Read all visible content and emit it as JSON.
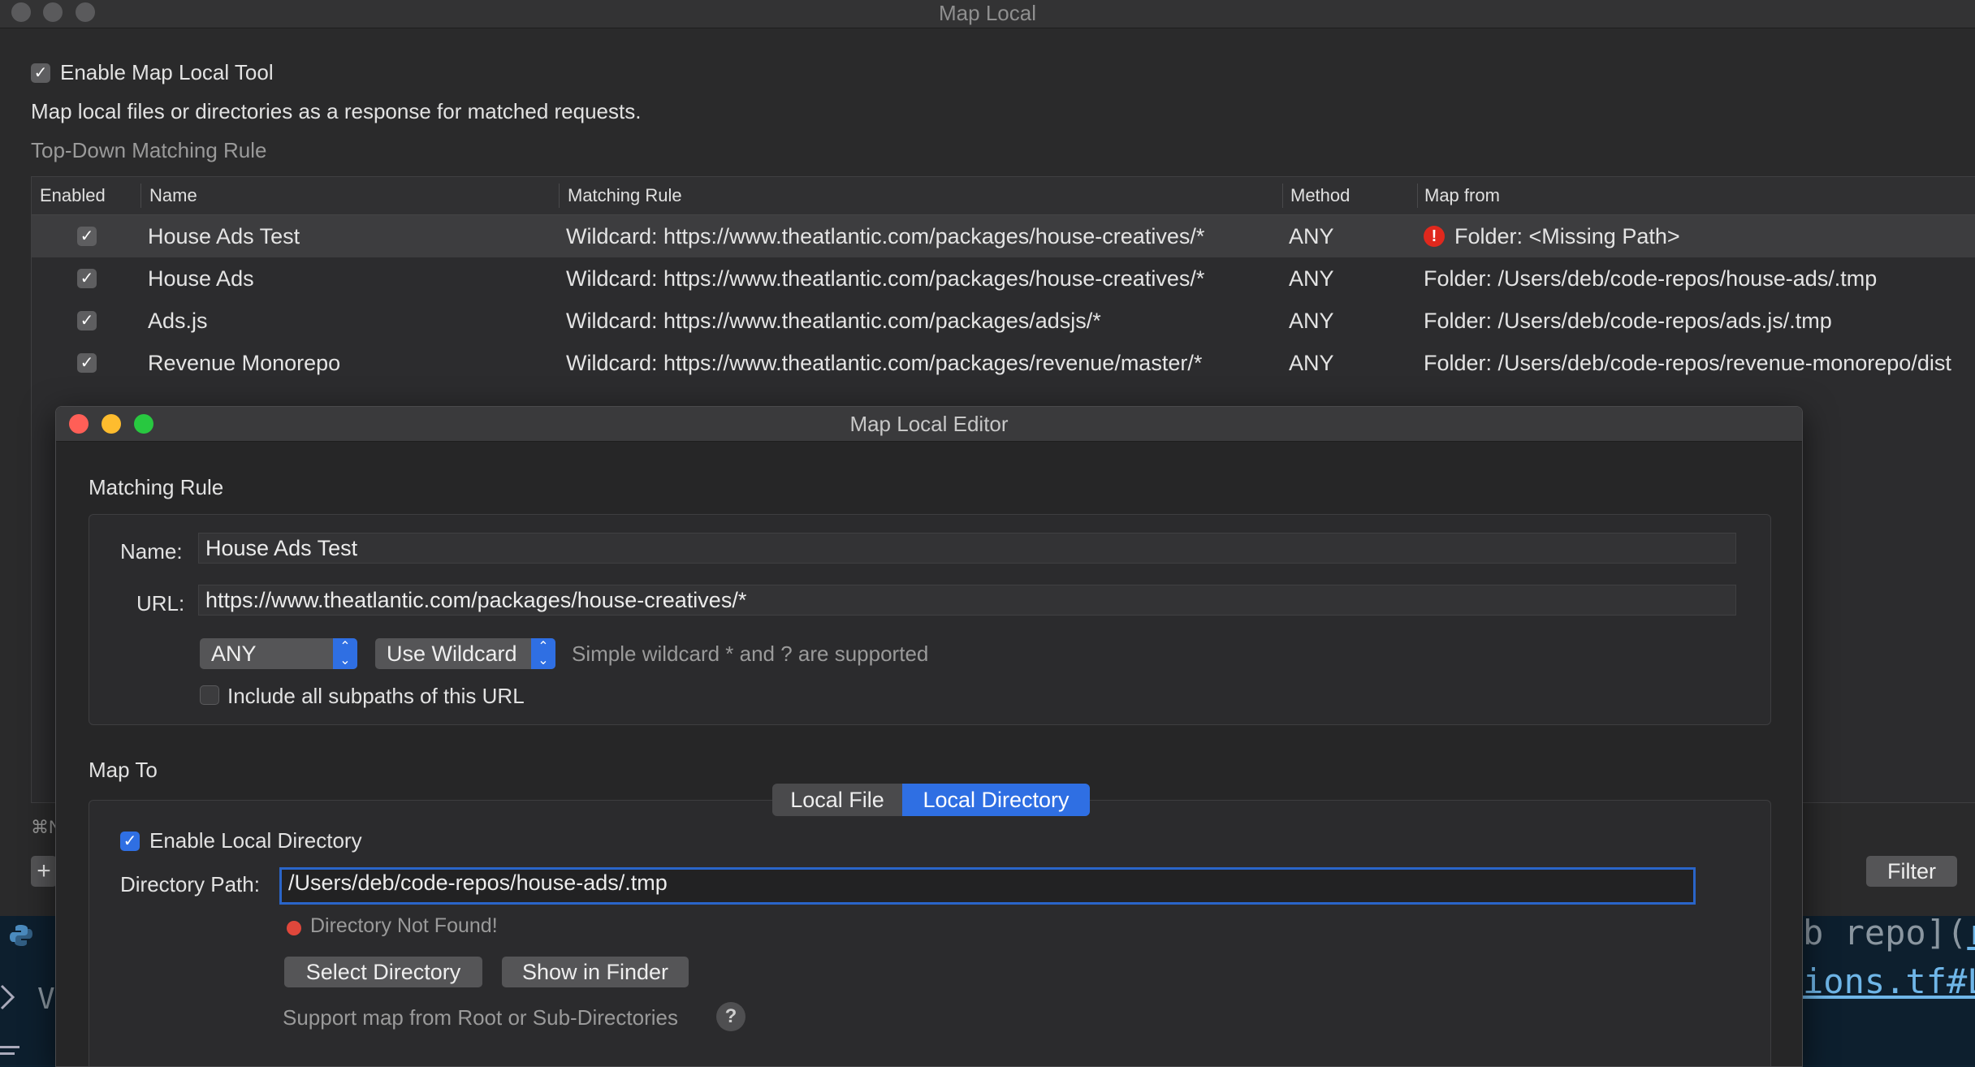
{
  "window": {
    "title": "Map Local"
  },
  "main": {
    "enable_label": "Enable Map Local Tool",
    "description": "Map local files or directories as a response for matched requests.",
    "section_label": "Top-Down Matching Rule",
    "shortcut_hint": "⌘N",
    "add_button": "+",
    "filter_button": "Filter"
  },
  "table": {
    "headers": {
      "enabled": "Enabled",
      "name": "Name",
      "rule": "Matching Rule",
      "method": "Method",
      "map_from": "Map from"
    },
    "rows": [
      {
        "name": "House Ads Test",
        "rule": "Wildcard: https://www.theatlantic.com/packages/house-creatives/*",
        "method": "ANY",
        "map_from": "Folder: <Missing Path>"
      },
      {
        "name": "House Ads",
        "rule": "Wildcard: https://www.theatlantic.com/packages/house-creatives/*",
        "method": "ANY",
        "map_from": "Folder: /Users/deb/code-repos/house-ads/.tmp"
      },
      {
        "name": "Ads.js",
        "rule": "Wildcard: https://www.theatlantic.com/packages/adsjs/*",
        "method": "ANY",
        "map_from": "Folder: /Users/deb/code-repos/ads.js/.tmp"
      },
      {
        "name": "Revenue Monorepo",
        "rule": "Wildcard: https://www.theatlantic.com/packages/revenue/master/*",
        "method": "ANY",
        "map_from": "Folder: /Users/deb/code-repos/revenue-monorepo/dist"
      }
    ]
  },
  "editor": {
    "title": "Map Local Editor",
    "matching_rule_label": "Matching Rule",
    "name_label": "Name:",
    "name_value": "House Ads Test",
    "url_label": "URL:",
    "url_value": "https://www.theatlantic.com/packages/house-creatives/*",
    "method_value": "ANY",
    "match_type_value": "Use Wildcard",
    "wildcard_hint": "Simple wildcard * and ? are supported",
    "subpaths_label": "Include all subpaths of this URL",
    "map_to_label": "Map To",
    "tab_local_file": "Local File",
    "tab_local_directory": "Local Directory",
    "enable_dir_label": "Enable Local Directory",
    "dir_path_label": "Directory Path:",
    "dir_path_value": "/Users/deb/code-repos/house-ads/.tmp",
    "dir_error": "Directory Not Found!",
    "select_dir_button": "Select Directory",
    "show_finder_button": "Show in Finder",
    "support_hint": "Support map from Root or Sub-Directories",
    "help_glyph": "?"
  },
  "background_code": {
    "line1": "b repo](",
    "line1_end": "r",
    "line2": "ions.tf#L",
    "side_glyph": "V"
  },
  "colors": {
    "accent": "#2f6fe3",
    "error": "#e0281d",
    "background": "#2a2a2b"
  }
}
